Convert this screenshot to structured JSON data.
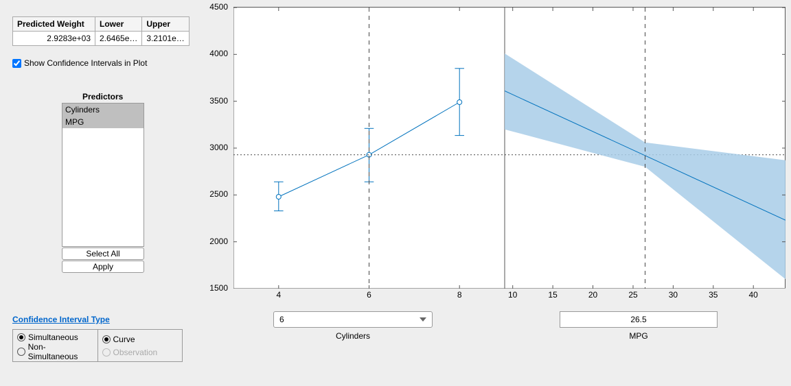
{
  "table": {
    "headers": [
      "Predicted Weight",
      "Lower",
      "Upper"
    ],
    "row": {
      "pred": "2.9283e+03",
      "lower": "2.6465e…",
      "upper": "3.2101e…"
    }
  },
  "checkbox_label": "Show Confidence Intervals in Plot",
  "predictors": {
    "title": "Predictors",
    "items": [
      "Cylinders",
      "MPG"
    ],
    "select_all": "Select All",
    "apply": "Apply"
  },
  "ci_link": "Confidence Interval Type",
  "ci_radios": {
    "col1": [
      "Simultaneous",
      "Non-Simultaneous"
    ],
    "col2": [
      "Curve",
      "Observation"
    ]
  },
  "controls": {
    "cyl_label": "Cylinders",
    "mpg_label": "MPG",
    "cyl_value": "6",
    "mpg_value": "26.5"
  },
  "yticks": [
    "1500",
    "2000",
    "2500",
    "3000",
    "3500",
    "4000",
    "4500"
  ],
  "xticks_left": [
    "4",
    "6",
    "8"
  ],
  "xticks_right": [
    "10",
    "15",
    "20",
    "25",
    "30",
    "35",
    "40"
  ],
  "chart_data": [
    {
      "type": "line",
      "panel": "Cylinders",
      "x": [
        4,
        6,
        8
      ],
      "y": [
        2480,
        2928,
        3490
      ],
      "ci_lower": [
        2330,
        2640,
        3135
      ],
      "ci_upper": [
        2640,
        3210,
        3850
      ],
      "reference_x": 6,
      "reference_y": 2928,
      "ylabel": "",
      "xlabel": "Cylinders",
      "ylim": [
        1500,
        4500
      ],
      "xlim": [
        3,
        9
      ]
    },
    {
      "type": "line",
      "panel": "MPG",
      "x": [
        9,
        44
      ],
      "y": [
        3610,
        2230
      ],
      "ci_band": {
        "x": [
          9,
          26.5,
          44
        ],
        "lower": [
          3200,
          2800,
          1600
        ],
        "upper": [
          4010,
          3060,
          2870
        ]
      },
      "reference_x": 26.5,
      "reference_y": 2928,
      "ylabel": "",
      "xlabel": "MPG",
      "ylim": [
        1500,
        4500
      ],
      "xlim": [
        9,
        44
      ]
    }
  ]
}
